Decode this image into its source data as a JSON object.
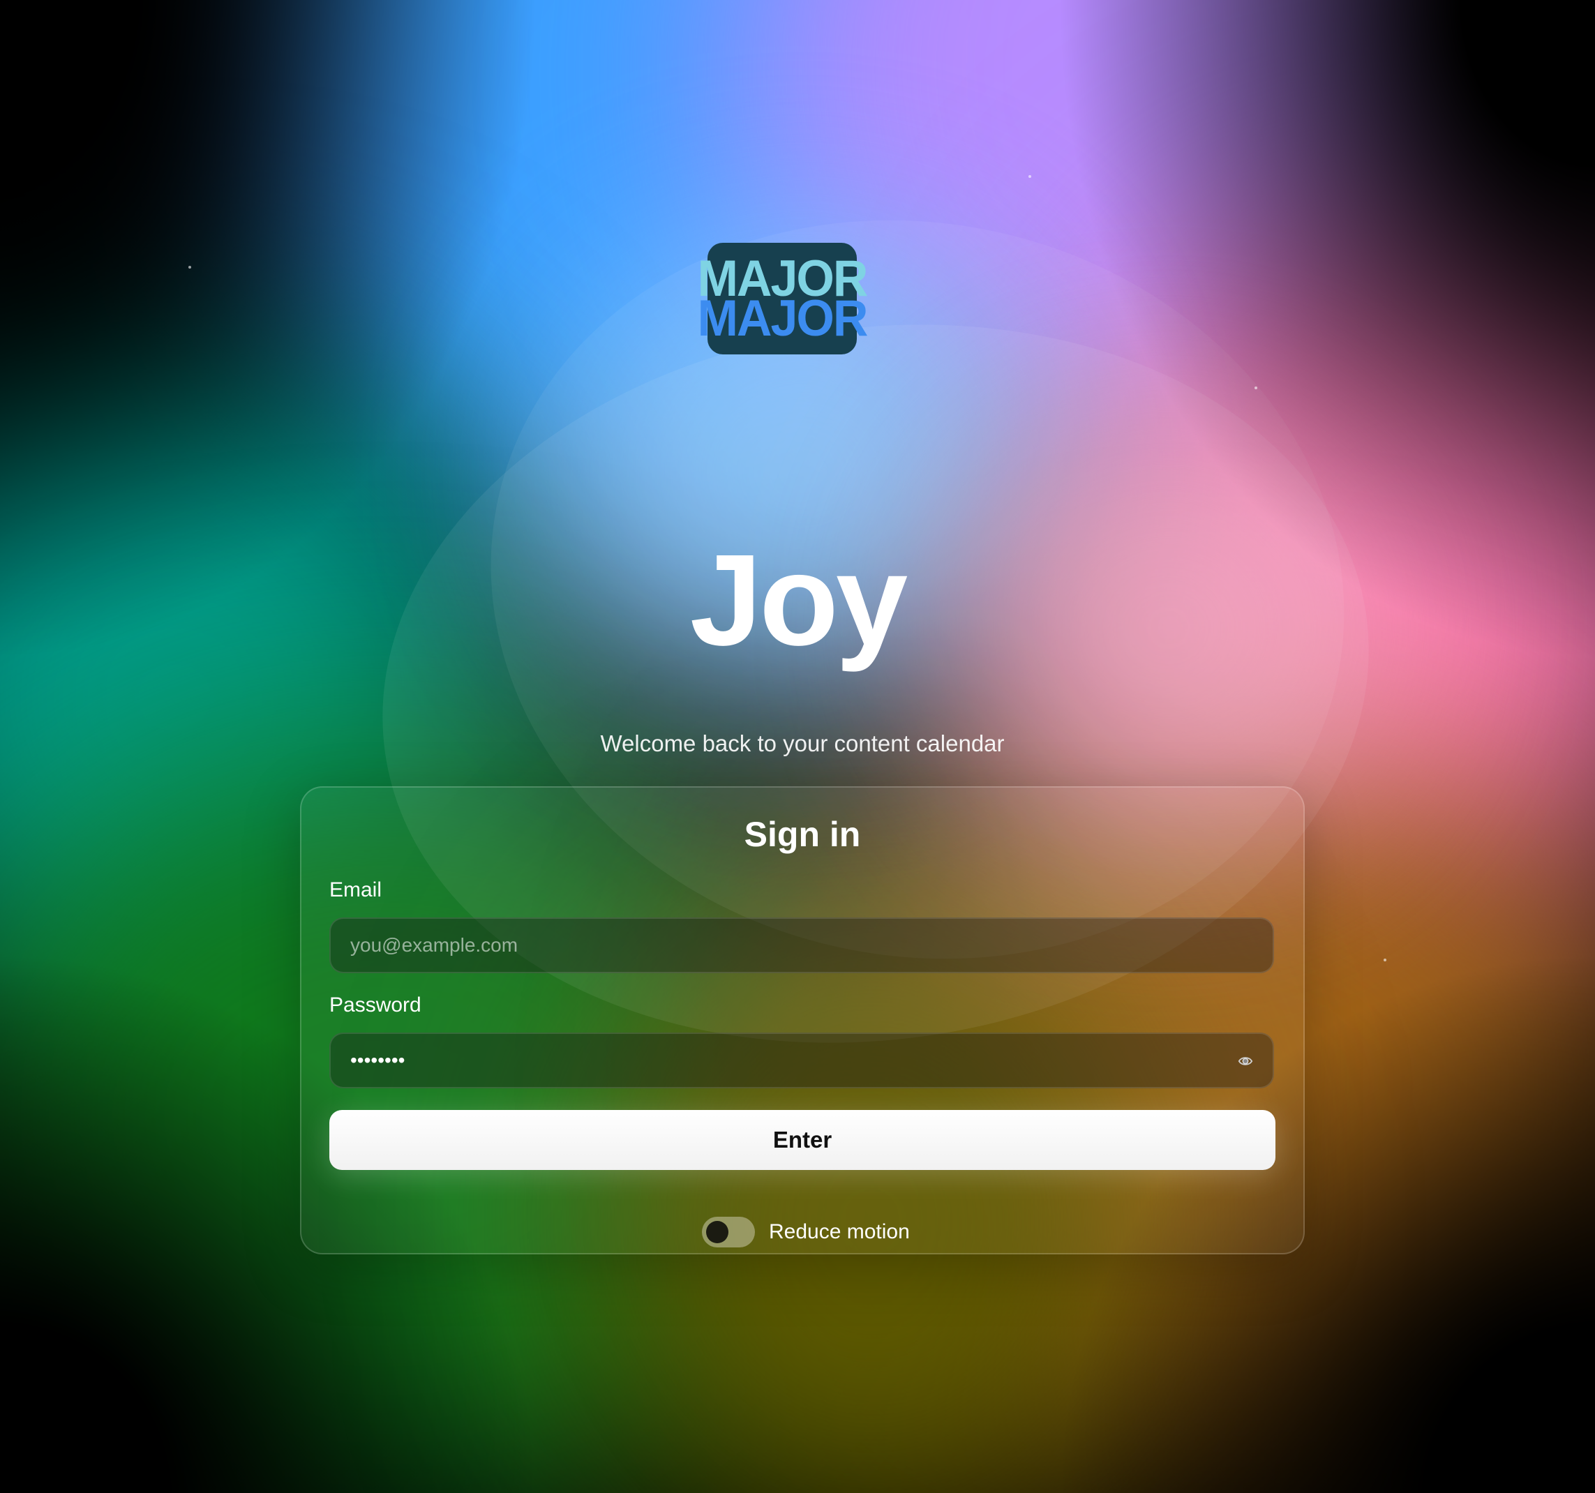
{
  "logo": {
    "line1": "MAJOR",
    "line2": "MAJOR",
    "colors": {
      "background": "#17404f",
      "top": "#7fd3e3",
      "bottom": "#3c8cf0"
    }
  },
  "app_title": "Joy",
  "subtitle": "Welcome back to your content calendar",
  "signin": {
    "title": "Sign in",
    "email_label": "Email",
    "email_placeholder": "you@example.com",
    "email_value": "",
    "password_label": "Password",
    "password_value": "••••••••",
    "show_password_icon": "eye-icon",
    "submit_label": "Enter"
  },
  "reduce_motion": {
    "label": "Reduce motion",
    "enabled": false
  }
}
